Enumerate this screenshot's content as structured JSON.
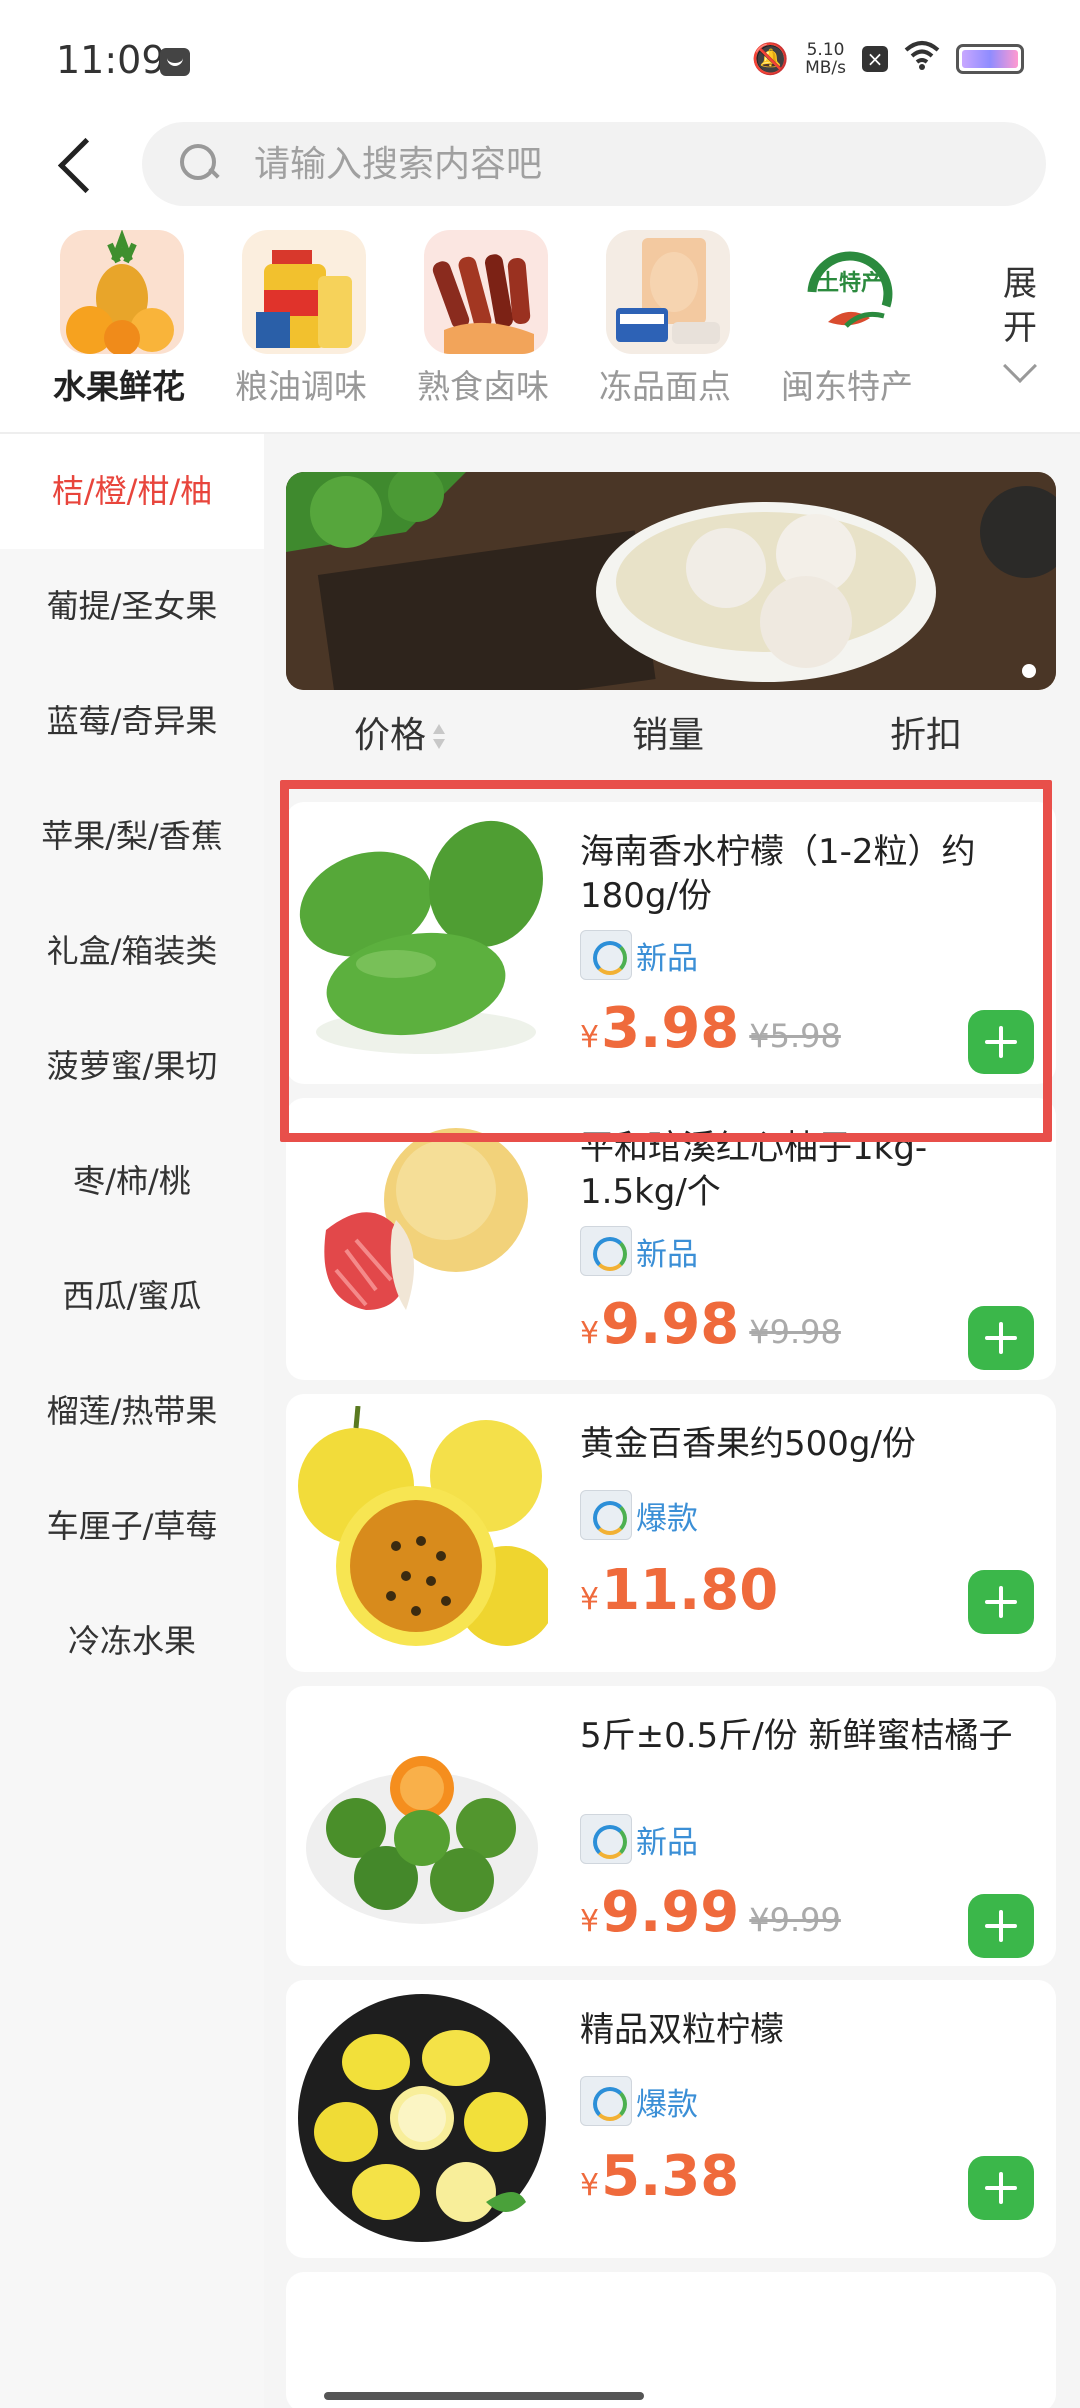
{
  "status_bar": {
    "time": "11:09",
    "speed_value": "5.10",
    "speed_unit": "MB/s",
    "icons": [
      "message-icon",
      "bell-muted-icon",
      "close-box-icon",
      "wifi-icon",
      "battery-icon"
    ]
  },
  "search": {
    "placeholder": "请输入搜索内容吧",
    "icon": "search-icon"
  },
  "categories": [
    {
      "label": "水果鲜花",
      "active": true
    },
    {
      "label": "粮油调味",
      "active": false
    },
    {
      "label": "熟食卤味",
      "active": false
    },
    {
      "label": "冻品面点",
      "active": false
    },
    {
      "label": "闽东特产",
      "active": false
    }
  ],
  "expand": {
    "label": "展开"
  },
  "sidebar": {
    "items": [
      {
        "label": "桔/橙/柑/柚",
        "active": true
      },
      {
        "label": "葡提/圣女果"
      },
      {
        "label": "蓝莓/奇异果"
      },
      {
        "label": "苹果/梨/香蕉"
      },
      {
        "label": "礼盒/箱装类"
      },
      {
        "label": "菠萝蜜/果切"
      },
      {
        "label": "枣/柿/桃"
      },
      {
        "label": "西瓜/蜜瓜"
      },
      {
        "label": "榴莲/热带果"
      },
      {
        "label": "车厘子/草莓"
      },
      {
        "label": "冷冻水果"
      }
    ]
  },
  "sort": {
    "price": "价格",
    "sales": "销量",
    "discount": "折扣"
  },
  "currency": "¥",
  "products": [
    {
      "title": "海南香水柠檬（1-2粒）约180g/份",
      "tag": "新品",
      "price": "3.98",
      "original_price": "¥5.98"
    },
    {
      "title": "平和琯溪红心柚子1kg-1.5kg/个",
      "tag": "新品",
      "price": "9.98",
      "original_price": "¥9.98"
    },
    {
      "title": "黄金百香果约500g/份",
      "tag": "爆款",
      "price": "11.80",
      "original_price": ""
    },
    {
      "title": "5斤±0.5斤/份  新鲜蜜桔橘子",
      "tag": "新品",
      "price": "9.99",
      "original_price": "¥9.99"
    },
    {
      "title": "精品双粒柠檬",
      "tag": "爆款",
      "price": "5.38",
      "original_price": ""
    }
  ],
  "colors": {
    "accent_red": "#e8453c",
    "price_orange": "#ef6a3c",
    "add_green": "#3bb74a",
    "tag_blue": "#3b8fd6",
    "highlight_red": "#e84f4a"
  }
}
